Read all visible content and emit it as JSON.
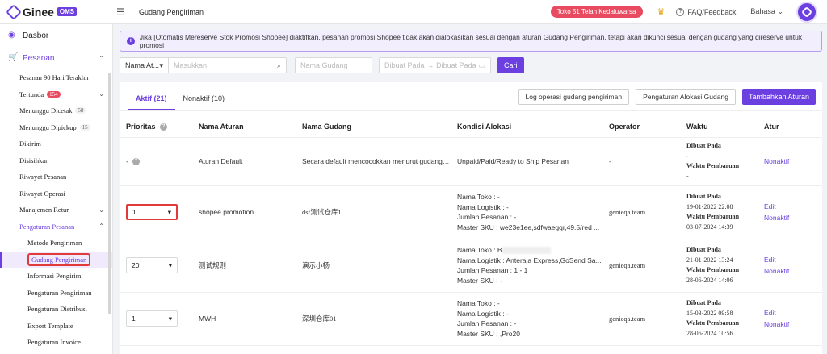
{
  "topbar": {
    "logo_text": "Ginee",
    "logo_badge": "OMS",
    "page_title": "Gudang Pengiriman",
    "expired_label": "Toko 51 Telah Kedaluwarsa",
    "faq_label": "FAQ/Feedback",
    "language_label": "Bahasa"
  },
  "sidebar": {
    "dashboard": "Dasbor",
    "orders": "Pesanan",
    "items": [
      {
        "label": "Pesanan 90 Hari Terakhir"
      },
      {
        "label": "Tertunda",
        "count": "154"
      },
      {
        "label": "Menunggu Dicetak",
        "count": "58"
      },
      {
        "label": "Menunggu Dipickup",
        "count": "15"
      },
      {
        "label": "Dikirim"
      },
      {
        "label": "Disisihkan"
      },
      {
        "label": "Riwayat Pesanan"
      },
      {
        "label": "Riwayat Operasi"
      },
      {
        "label": "Manajemen Retur"
      },
      {
        "label": "Pengaturan Pesanan"
      }
    ],
    "sub_items": [
      {
        "label": "Metode Pengiriman"
      },
      {
        "label": "Gudang Pengiriman"
      },
      {
        "label": "Informasi Pengirim"
      },
      {
        "label": "Pengaturan Pengiriman"
      },
      {
        "label": "Pengaturan Distribusi"
      },
      {
        "label": "Export Template"
      },
      {
        "label": "Pengaturan Invoice"
      }
    ]
  },
  "notice": "Jika [Otomatis Mereserve Stok Promosi Shopee] diaktifkan, pesanan promosi Shopee tidak akan dialokasikan sesuai dengan aturan Gudang Pengiriman, tetapi akan dikunci sesuai dengan gudang yang direserve untuk promosi",
  "filters": {
    "search_type": "Nama At...",
    "search_placeholder": "Masukkan",
    "warehouse_placeholder": "Nama Gudang",
    "date_from_placeholder": "Dibuat Pada",
    "date_arrow": "→",
    "date_to_placeholder": "Dibuat Pada",
    "search_button": "Cari"
  },
  "tabs": {
    "active": "Aktif (21)",
    "inactive": "Nonaktif (10)"
  },
  "actions": {
    "log": "Log operasi gudang pengiriman",
    "allocation": "Pengaturan Alokasi Gudang",
    "add": "Tambahkan Aturan"
  },
  "table": {
    "headers": [
      "Prioritas",
      "Nama Aturan",
      "Nama Gudang",
      "Kondisi Alokasi",
      "Operator",
      "Waktu",
      "Atur"
    ],
    "labels": {
      "created": "Dibuat Pada",
      "updated": "Waktu Pembaruan",
      "shop": "Nama Toko : ",
      "logistic": "Nama Logistik : ",
      "qty": "Jumlah Pesanan : ",
      "sku": "Master SKU : ",
      "edit": "Edit",
      "deactivate": "Nonaktif"
    },
    "rows": [
      {
        "priority": "-",
        "name": "Aturan Default",
        "warehouse": "Secara default mencocokkan menurut gudang i...",
        "condition": "Unpaid/Paid/Ready to Ship Pesanan",
        "operator": "-",
        "created": "-",
        "updated": "-"
      },
      {
        "priority": "1",
        "name": "shopee promotion",
        "warehouse": "dsf测试仓库1",
        "shop": "-",
        "logistic": "-",
        "qty": "-",
        "sku": "we23e1ee,sdfwaegqr,49.5/red ...",
        "operator": "genieqa.team",
        "created": "19-01-2022 22:08",
        "updated": "03-07-2024 14:39"
      },
      {
        "priority": "20",
        "name": "测试规则",
        "warehouse": "演示小杨",
        "shop": "B",
        "logistic": "Anteraja Express,GoSend Sa...",
        "qty": "1 - 1",
        "sku": "-",
        "operator": "genieqa.team",
        "created": "21-01-2022 13:24",
        "updated": "28-06-2024 14:06"
      },
      {
        "priority": "1",
        "name": "MWH",
        "warehouse": "深圳仓库01",
        "shop": "-",
        "logistic": "-",
        "qty": "-",
        "sku": ",Pro20",
        "operator": "genieqa.team",
        "created": "15-03-2022 09:58",
        "updated": "28-06-2024 10:56"
      }
    ]
  }
}
